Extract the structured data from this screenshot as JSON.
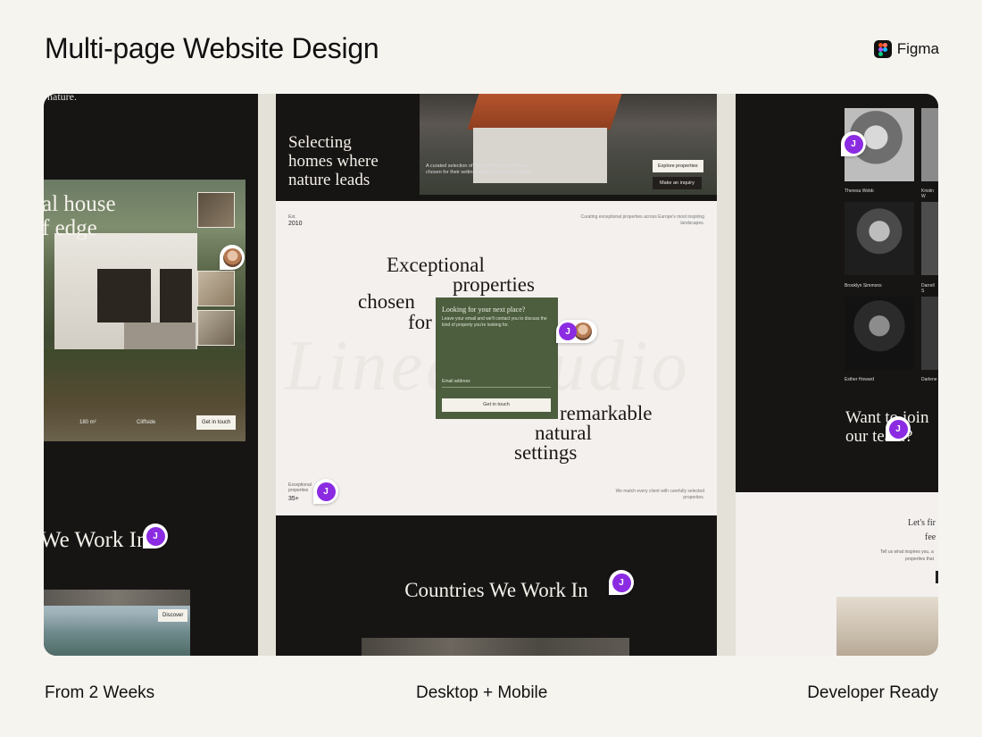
{
  "header": {
    "title": "Multi-page Website Design",
    "tool_label": "Figma",
    "tool_icon": "figma-icon"
  },
  "left_panel": {
    "top_text": "nature.",
    "hero_title_line1": "al house",
    "hero_title_line2": "f edge",
    "stat_area": "180 m²",
    "stat_location": "Cliffside",
    "cta": "Get in touch",
    "section_heading": "We Work In",
    "discover": "Discover"
  },
  "center_panel": {
    "hero_title_line1": "Selecting",
    "hero_title_line2": "homes where",
    "hero_title_line3": "nature leads",
    "hero_desc": "A curated selection of properties across Europe, chosen for their setting, light, and sense of place.",
    "explore_btn": "Explore properties",
    "inquiry_btn": "Make an inquiry",
    "est_label": "Est.",
    "est_year": "2010",
    "curating": "Curating exceptional properties across Europe's most inspiring landscapes.",
    "headline_1": "Exceptional",
    "headline_2": "properties",
    "headline_3": "chosen",
    "headline_4": "for",
    "headline_5": "remarkable",
    "headline_6": "natural",
    "headline_7": "settings",
    "form_title": "Looking for your next place?",
    "form_desc": "Leave your email and we'll contact you to discuss the kind of property you're looking for.",
    "form_label": "Email address",
    "form_btn": "Get in touch",
    "exceptional_label_1": "Exceptional",
    "exceptional_label_2": "properties",
    "exceptional_value": "35+",
    "match_text": "We match every client with carefully selected properties.",
    "countries_heading": "Countries We Work In"
  },
  "right_panel": {
    "team": [
      {
        "name": "Theresa Webb"
      },
      {
        "name": "Kristin W"
      },
      {
        "name": "Brooklyn Simmons"
      },
      {
        "name": "Darrell S"
      },
      {
        "name": "Esther Howard"
      },
      {
        "name": "Darlene"
      }
    ],
    "join_line1": "Want to join",
    "join_line2": "our team?",
    "contact_title1": "Let's fir",
    "contact_title2": "fee",
    "contact_desc1": "Tell us what inspires you, a",
    "contact_desc2": "properties that"
  },
  "cursors": {
    "avatar_initial": "J",
    "accent": "#8b2be2"
  },
  "footer": {
    "left": "From 2 Weeks",
    "center": "Desktop + Mobile",
    "right": "Developer Ready"
  }
}
